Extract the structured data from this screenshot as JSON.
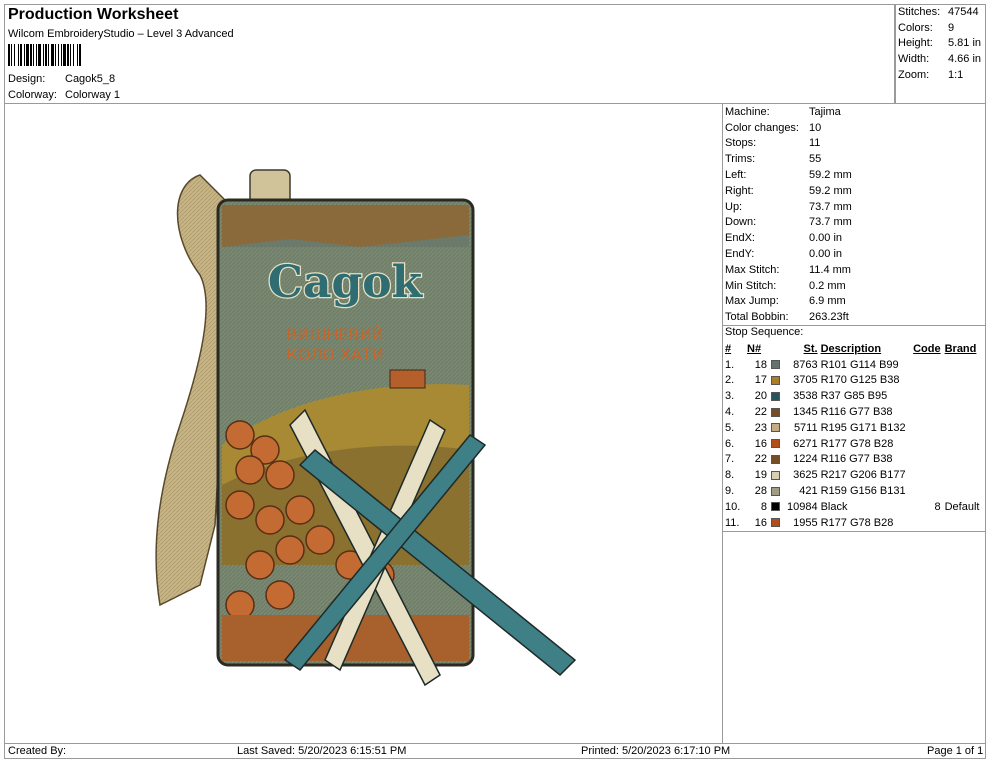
{
  "header": {
    "title": "Production Worksheet",
    "software": "Wilcom EmbroideryStudio – Level 3 Advanced",
    "design_label": "Design:",
    "design_value": "Cagok5_8",
    "colorway_label": "Colorway:",
    "colorway_value": "Colorway 1"
  },
  "summary": [
    {
      "label": "Stitches:",
      "value": "47544"
    },
    {
      "label": "Colors:",
      "value": "9"
    },
    {
      "label": "Height:",
      "value": "5.81 in"
    },
    {
      "label": "Width:",
      "value": "4.66 in"
    },
    {
      "label": "Zoom:",
      "value": "1:1"
    }
  ],
  "machine_info": [
    {
      "label": "Machine:",
      "value": "Tajima"
    },
    {
      "label": "Color changes:",
      "value": "10"
    },
    {
      "label": "Stops:",
      "value": "11"
    },
    {
      "label": "Trims:",
      "value": "55"
    },
    {
      "label": "Left:",
      "value": "59.2 mm"
    },
    {
      "label": "Right:",
      "value": "59.2 mm"
    },
    {
      "label": "Up:",
      "value": "73.7 mm"
    },
    {
      "label": "Down:",
      "value": "73.7 mm"
    },
    {
      "label": "EndX:",
      "value": "0.00 in"
    },
    {
      "label": "EndY:",
      "value": "0.00 in"
    },
    {
      "label": "Max Stitch:",
      "value": "11.4 mm"
    },
    {
      "label": "Min Stitch:",
      "value": "0.2 mm"
    },
    {
      "label": "Max Jump:",
      "value": "6.9 mm"
    },
    {
      "label": "Total Bobbin:",
      "value": "263.23ft"
    }
  ],
  "stop_sequence": {
    "label": "Stop Sequence:",
    "headers": {
      "num": "#",
      "n": "N#",
      "st": "St.",
      "desc": "Description",
      "code": "Code",
      "brand": "Brand"
    },
    "rows": [
      {
        "num": "1.",
        "n": "18",
        "color": "#65726B",
        "st": "8763",
        "desc": "R101 G114 B99",
        "code": "",
        "brand": ""
      },
      {
        "num": "2.",
        "n": "17",
        "color": "#AA7D26",
        "st": "3705",
        "desc": "R170 G125 B38",
        "code": "",
        "brand": ""
      },
      {
        "num": "3.",
        "n": "20",
        "color": "#25555F",
        "st": "3538",
        "desc": "R37 G85 B95",
        "code": "",
        "brand": ""
      },
      {
        "num": "4.",
        "n": "22",
        "color": "#744D26",
        "st": "1345",
        "desc": "R116 G77 B38",
        "code": "",
        "brand": ""
      },
      {
        "num": "5.",
        "n": "23",
        "color": "#C3AB84",
        "st": "5711",
        "desc": "R195 G171 B132",
        "code": "",
        "brand": ""
      },
      {
        "num": "6.",
        "n": "16",
        "color": "#B14E1C",
        "st": "6271",
        "desc": "R177 G78 B28",
        "code": "",
        "brand": ""
      },
      {
        "num": "7.",
        "n": "22",
        "color": "#744D26",
        "st": "1224",
        "desc": "R116 G77 B38",
        "code": "",
        "brand": ""
      },
      {
        "num": "8.",
        "n": "19",
        "color": "#D9CEB1",
        "st": "3625",
        "desc": "R217 G206 B177",
        "code": "",
        "brand": ""
      },
      {
        "num": "9.",
        "n": "28",
        "color": "#9F9C83",
        "st": "421",
        "desc": "R159 G156 B131",
        "code": "",
        "brand": ""
      },
      {
        "num": "10.",
        "n": "8",
        "color": "#000000",
        "st": "10984",
        "desc": "Black",
        "code": "8",
        "brand": "Default"
      },
      {
        "num": "11.",
        "n": "16",
        "color": "#B14E1C",
        "st": "1955",
        "desc": "R177 G78 B28",
        "code": "",
        "brand": ""
      }
    ]
  },
  "design_image": {
    "brand_text": "Cagok",
    "subtitle_line1": "ВИШНЕВИЙ",
    "subtitle_line2": "КОЛО ХАТИ"
  },
  "footer": {
    "created_by": "Created By:",
    "last_saved": "Last Saved: 5/20/2023 6:15:51 PM",
    "printed": "Printed: 5/20/2023 6:17:10 PM",
    "page": "Page 1 of 1"
  }
}
